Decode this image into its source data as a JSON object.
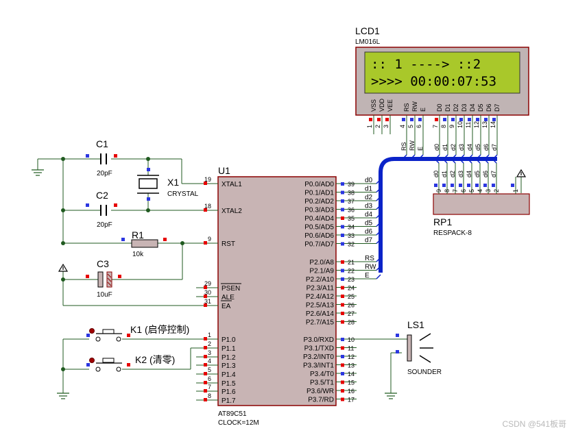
{
  "lcd": {
    "ref": "LCD1",
    "model": "LM016L",
    "line1": ":: 1 ----> ::2",
    "line2": ">>>> 00:00:07:53",
    "pins": [
      "VSS",
      "VDD",
      "VEE",
      "RS",
      "RW",
      "E",
      "D0",
      "D1",
      "D2",
      "D3",
      "D4",
      "D5",
      "D6",
      "D7"
    ],
    "pin_numbers": [
      "1",
      "2",
      "3",
      "4",
      "5",
      "6",
      "7",
      "8",
      "9",
      "10",
      "11",
      "12",
      "13",
      "14"
    ],
    "colors": {
      "screen": "#a9c82a",
      "body": "#c0b4b4",
      "border": "#8b0000",
      "text": "#13222d"
    }
  },
  "mcu": {
    "ref": "U1",
    "model": "AT89C51",
    "clock": "CLOCK=12M",
    "left_pins": [
      {
        "num": "19",
        "name": "XTAL1"
      },
      {
        "num": "18",
        "name": "XTAL2"
      },
      {
        "num": "9",
        "name": "RST"
      },
      {
        "num": "29",
        "name": "PSEN"
      },
      {
        "num": "30",
        "name": "ALE"
      },
      {
        "num": "31",
        "name": "EA"
      },
      {
        "num": "1",
        "name": "P1.0"
      },
      {
        "num": "2",
        "name": "P1.1"
      },
      {
        "num": "3",
        "name": "P1.2"
      },
      {
        "num": "4",
        "name": "P1.3"
      },
      {
        "num": "5",
        "name": "P1.4"
      },
      {
        "num": "6",
        "name": "P1.5"
      },
      {
        "num": "7",
        "name": "P1.6"
      },
      {
        "num": "8",
        "name": "P1.7"
      }
    ],
    "right_pins": [
      {
        "num": "39",
        "name": "P0.0/AD0",
        "net": "d0"
      },
      {
        "num": "38",
        "name": "P0.1/AD1",
        "net": "d1"
      },
      {
        "num": "37",
        "name": "P0.2/AD2",
        "net": "d2"
      },
      {
        "num": "36",
        "name": "P0.3/AD3",
        "net": "d3"
      },
      {
        "num": "35",
        "name": "P0.4/AD4",
        "net": "d4"
      },
      {
        "num": "34",
        "name": "P0.5/AD5",
        "net": "d5"
      },
      {
        "num": "33",
        "name": "P0.6/AD6",
        "net": "d6"
      },
      {
        "num": "32",
        "name": "P0.7/AD7",
        "net": "d7"
      },
      {
        "num": "21",
        "name": "P2.0/A8",
        "net": "RS"
      },
      {
        "num": "22",
        "name": "P2.1/A9",
        "net": "RW"
      },
      {
        "num": "23",
        "name": "P2.2/A10",
        "net": "E"
      },
      {
        "num": "24",
        "name": "P2.3/A11",
        "net": ""
      },
      {
        "num": "25",
        "name": "P2.4/A12",
        "net": ""
      },
      {
        "num": "26",
        "name": "P2.5/A13",
        "net": ""
      },
      {
        "num": "27",
        "name": "P2.6/A14",
        "net": ""
      },
      {
        "num": "28",
        "name": "P2.7/A15",
        "net": ""
      },
      {
        "num": "10",
        "name": "P3.0/RXD",
        "net": ""
      },
      {
        "num": "11",
        "name": "P3.1/TXD",
        "net": ""
      },
      {
        "num": "12",
        "name": "P3.2/INT0",
        "net": ""
      },
      {
        "num": "13",
        "name": "P3.3/INT1",
        "net": ""
      },
      {
        "num": "14",
        "name": "P3.4/T0",
        "net": ""
      },
      {
        "num": "15",
        "name": "P3.5/T1",
        "net": ""
      },
      {
        "num": "16",
        "name": "P3.6/WR",
        "net": ""
      },
      {
        "num": "17",
        "name": "P3.7/RD",
        "net": ""
      }
    ],
    "colors": {
      "body": "#c8b4b4",
      "border": "#8b0000"
    }
  },
  "lcd_wire_labels": [
    "RS",
    "RW",
    "E",
    "d0",
    "d1",
    "d2",
    "d3",
    "d4",
    "d5",
    "d6",
    "d7"
  ],
  "rp1": {
    "ref": "RP1",
    "model": "RESPACK-8",
    "labels": [
      "d0",
      "d1",
      "d2",
      "d3",
      "d4",
      "d5",
      "d6",
      "d7"
    ],
    "pin_numbers": [
      "9",
      "8",
      "7",
      "6",
      "5",
      "4",
      "3",
      "2",
      "1"
    ]
  },
  "c1": {
    "ref": "C1",
    "value": "20pF"
  },
  "c2": {
    "ref": "C2",
    "value": "20pF"
  },
  "c3": {
    "ref": "C3",
    "value": "10uF"
  },
  "r1": {
    "ref": "R1",
    "value": "10k"
  },
  "x1": {
    "ref": "X1",
    "value": "CRYSTAL"
  },
  "k1": {
    "label": "K1 (启停控制)"
  },
  "k2": {
    "label": "K2 (清零)"
  },
  "ls1": {
    "ref": "LS1",
    "model": "SOUNDER"
  },
  "watermark": "CSDN @541板哥",
  "colors": {
    "bus": "#0b23c8",
    "wire": "#1f5a1f",
    "pin_red": "#e60000",
    "pin_blue": "#2b36e0"
  }
}
